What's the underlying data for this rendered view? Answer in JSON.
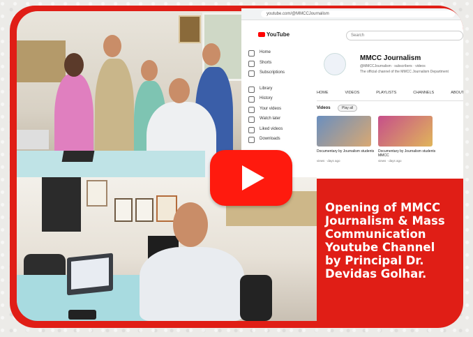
{
  "caption": {
    "line1": "Opening of MMCC",
    "line2": "Journalism & Mass",
    "line3": "Communication",
    "line4": "Youtube Channel",
    "line5": "by Principal Dr.",
    "line6": "Devidas Golhar."
  },
  "youtube": {
    "url": "youtube.com/@MMCCJournalism",
    "search_placeholder": "Search",
    "logo_text": "YouTube",
    "channel_name": "MMCC Journalism",
    "channel_handle": "@MMCCJournalism · subscribers · videos",
    "channel_description": "The official channel of the MMCC Journalism Department",
    "tabs": [
      "HOME",
      "VIDEOS",
      "PLAYLISTS",
      "CHANNELS",
      "ABOUT"
    ],
    "sidebar": [
      "Home",
      "Shorts",
      "Subscriptions",
      "Library",
      "History",
      "Your videos",
      "Watch later",
      "Liked videos",
      "Downloads"
    ],
    "videos_label": "Videos",
    "play_all_label": "Play all",
    "video1_title": "Documentary by Journalism students",
    "video1_meta": "views · days ago",
    "video2_title": "Documentary by Journalism students MMCC",
    "video2_meta": "views · days ago"
  },
  "colors": {
    "frame_red": "#e01e16",
    "play_red": "#ff1a0e"
  }
}
